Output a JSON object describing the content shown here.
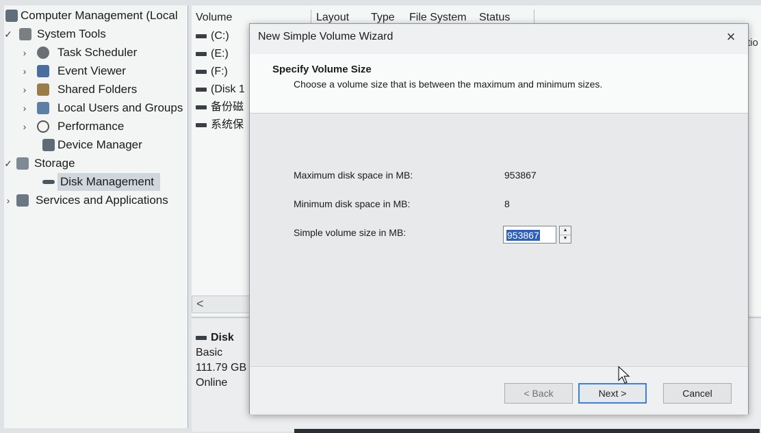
{
  "tree": {
    "root": "Computer Management (Local",
    "items": [
      {
        "label": "System Tools",
        "expanded": true
      },
      {
        "label": "Task Scheduler"
      },
      {
        "label": "Event Viewer"
      },
      {
        "label": "Shared Folders"
      },
      {
        "label": "Local Users and Groups"
      },
      {
        "label": "Performance"
      },
      {
        "label": "Device Manager"
      },
      {
        "label": "Storage",
        "expanded": true
      },
      {
        "label": "Disk Management",
        "selected": true
      },
      {
        "label": "Services and Applications"
      }
    ]
  },
  "volumes": {
    "columns": [
      "Volume",
      "Layout",
      "Type",
      "File System",
      "Status"
    ],
    "rows": [
      "(C:)",
      "(E:)",
      "(F:)",
      "(Disk 1",
      "备份磁",
      "系统保"
    ],
    "scroll_left": "<",
    "edge_text": "tio"
  },
  "disk_map": {
    "title": "Disk",
    "type": "Basic",
    "size": "111.79 GB",
    "status": "Online"
  },
  "dialog": {
    "title": "New Simple Volume Wizard",
    "close": "×",
    "heading": "Specify Volume Size",
    "subheading": "Choose a volume size that is between the maximum and minimum sizes.",
    "fields": {
      "max_label": "Maximum disk space in MB:",
      "max_value": "953867",
      "min_label": "Minimum disk space in MB:",
      "min_value": "8",
      "size_label": "Simple volume size in MB:",
      "size_value": "953867"
    },
    "buttons": {
      "back": "< Back",
      "next": "Next >",
      "cancel": "Cancel"
    }
  },
  "colors": {
    "selection": "#2e5fb8",
    "primary_border": "#3c7fd4"
  }
}
